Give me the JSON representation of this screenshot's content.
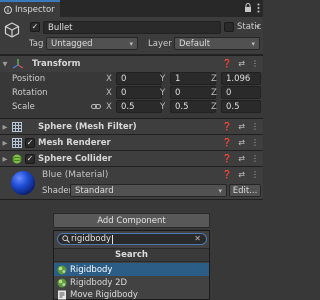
{
  "tab": {
    "title": "Inspector"
  },
  "object": {
    "name": "Bullet",
    "static_label": "Static",
    "tag_label": "Tag",
    "tag_value": "Untagged",
    "layer_label": "Layer",
    "layer_value": "Default"
  },
  "transform": {
    "title": "Transform",
    "rows": [
      {
        "label": "Position",
        "x": "0",
        "y": "1",
        "z": "1.096"
      },
      {
        "label": "Rotation",
        "x": "0",
        "y": "0",
        "z": "0"
      },
      {
        "label": "Scale",
        "x": "0.5",
        "y": "0.5",
        "z": "0.5"
      }
    ],
    "axis_x": "X",
    "axis_y": "Y",
    "axis_z": "Z"
  },
  "components": [
    {
      "name": "Sphere (Mesh Filter)"
    },
    {
      "name": "Mesh Renderer"
    },
    {
      "name": "Sphere Collider"
    }
  ],
  "material": {
    "name": "Blue (Material)",
    "shader_label": "Shader",
    "shader_value": "Standard",
    "edit_label": "Edit..."
  },
  "add_component": {
    "button_label": "Add Component",
    "search_value": "rigidbody",
    "list_title": "Search",
    "results": [
      "Rigidbody",
      "Rigidbody 2D",
      "Move Rigidbody"
    ]
  },
  "icons": {
    "inspector": "info-icon",
    "lock": "lock-icon",
    "menu": "kebab-menu-icon",
    "gameobject": "cube-icon",
    "transform": "transform-axes-icon",
    "help": "help-icon",
    "preset": "sliders-icon",
    "more": "kebab-menu-icon"
  },
  "colors": {
    "background": "#383838",
    "accent": "#3a79bb",
    "selection": "#2c5d87",
    "collider_green": "#7bc043",
    "material_blue": "#1f4fd6"
  }
}
